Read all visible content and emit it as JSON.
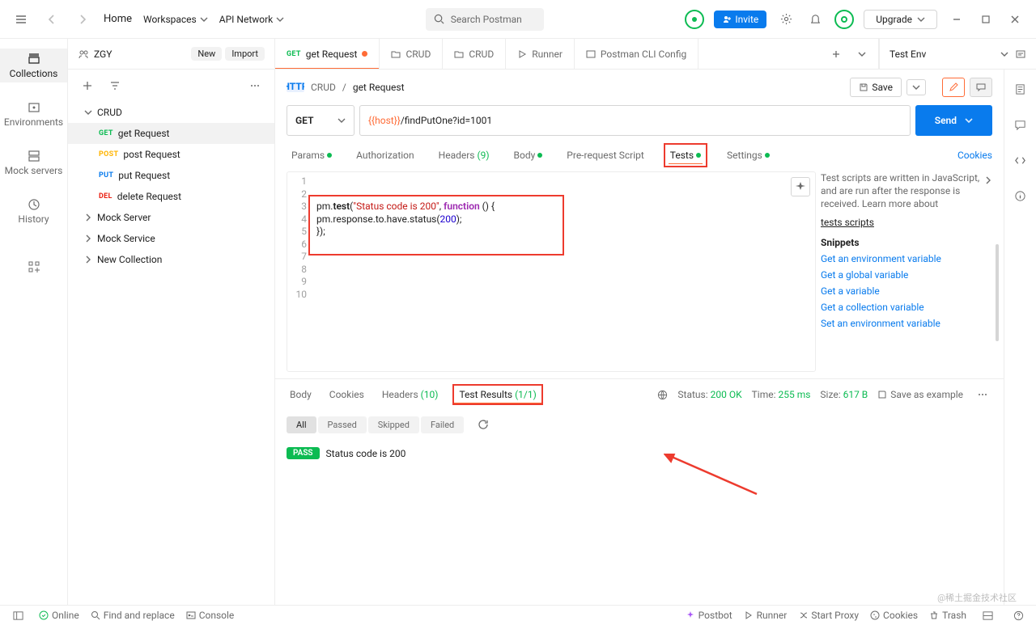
{
  "topbar": {
    "home": "Home",
    "workspaces": "Workspaces",
    "api_network": "API Network",
    "search_placeholder": "Search Postman",
    "invite": "Invite",
    "upgrade": "Upgrade"
  },
  "left_rail": {
    "collections": "Collections",
    "environments": "Environments",
    "mock_servers": "Mock servers",
    "history": "History"
  },
  "sidebar": {
    "workspace": "ZGY",
    "new_btn": "New",
    "import_btn": "Import",
    "tree": {
      "crud": "CRUD",
      "get_request": "get Request",
      "post_request": "post Request",
      "put_request": "put Request",
      "delete_request": "delete Request",
      "mock_server": "Mock Server",
      "mock_service": "Mock Service",
      "new_collection": "New Collection"
    },
    "methods": {
      "get": "GET",
      "post": "POST",
      "put": "PUT",
      "del": "DEL"
    }
  },
  "tabs": {
    "get_request": "get Request",
    "crud1": "CRUD",
    "crud2": "CRUD",
    "runner": "Runner",
    "cli": "Postman CLI Config",
    "env": "Test Env"
  },
  "breadcrumb": {
    "parent": "CRUD",
    "current": "get Request"
  },
  "save": {
    "label": "Save"
  },
  "request": {
    "method": "GET",
    "url_var": "{{host}}",
    "url_rest": "/findPutOne?id=1001",
    "send": "Send"
  },
  "req_tabs": {
    "params": "Params",
    "authorization": "Authorization",
    "headers": "Headers",
    "headers_count": "(9)",
    "body": "Body",
    "prerequest": "Pre-request Script",
    "tests": "Tests",
    "settings": "Settings",
    "cookies": "Cookies"
  },
  "editor": {
    "lines": [
      "1",
      "2",
      "3",
      "4",
      "5",
      "6",
      "7",
      "8",
      "9",
      "10"
    ],
    "l3a": "pm.",
    "l3b": "test",
    "l3c": "(",
    "l3d": "\"Status code is 200\"",
    "l3e": ", ",
    "l3f": "function",
    "l3g": " () {",
    "l4a": "    pm.response.to.have.status(",
    "l4b": "200",
    "l4c": ");",
    "l5": "});"
  },
  "snippets": {
    "desc": "Test scripts are written in JavaScript, and are run after the response is received. Learn more about",
    "link": "tests scripts",
    "header": "Snippets",
    "s1": "Get an environment variable",
    "s2": "Get a global variable",
    "s3": "Get a variable",
    "s4": "Get a collection variable",
    "s5": "Set an environment variable"
  },
  "response": {
    "tabs": {
      "body": "Body",
      "cookies": "Cookies",
      "headers": "Headers",
      "headers_count": "(10)",
      "test_results": "Test Results",
      "tr_count": "(1/1)"
    },
    "status_label": "Status:",
    "status_value": "200 OK",
    "time_label": "Time:",
    "time_value": "255 ms",
    "size_label": "Size:",
    "size_value": "617 B",
    "save_example": "Save as example",
    "filters": {
      "all": "All",
      "passed": "Passed",
      "skipped": "Skipped",
      "failed": "Failed"
    },
    "pass": "PASS",
    "result_text": "Status code is 200"
  },
  "footer": {
    "online": "Online",
    "find": "Find and replace",
    "console": "Console",
    "postbot": "Postbot",
    "runner": "Runner",
    "start_proxy": "Start Proxy",
    "cookies": "Cookies",
    "trash": "Trash"
  },
  "watermark": "@稀土掘金技术社区"
}
